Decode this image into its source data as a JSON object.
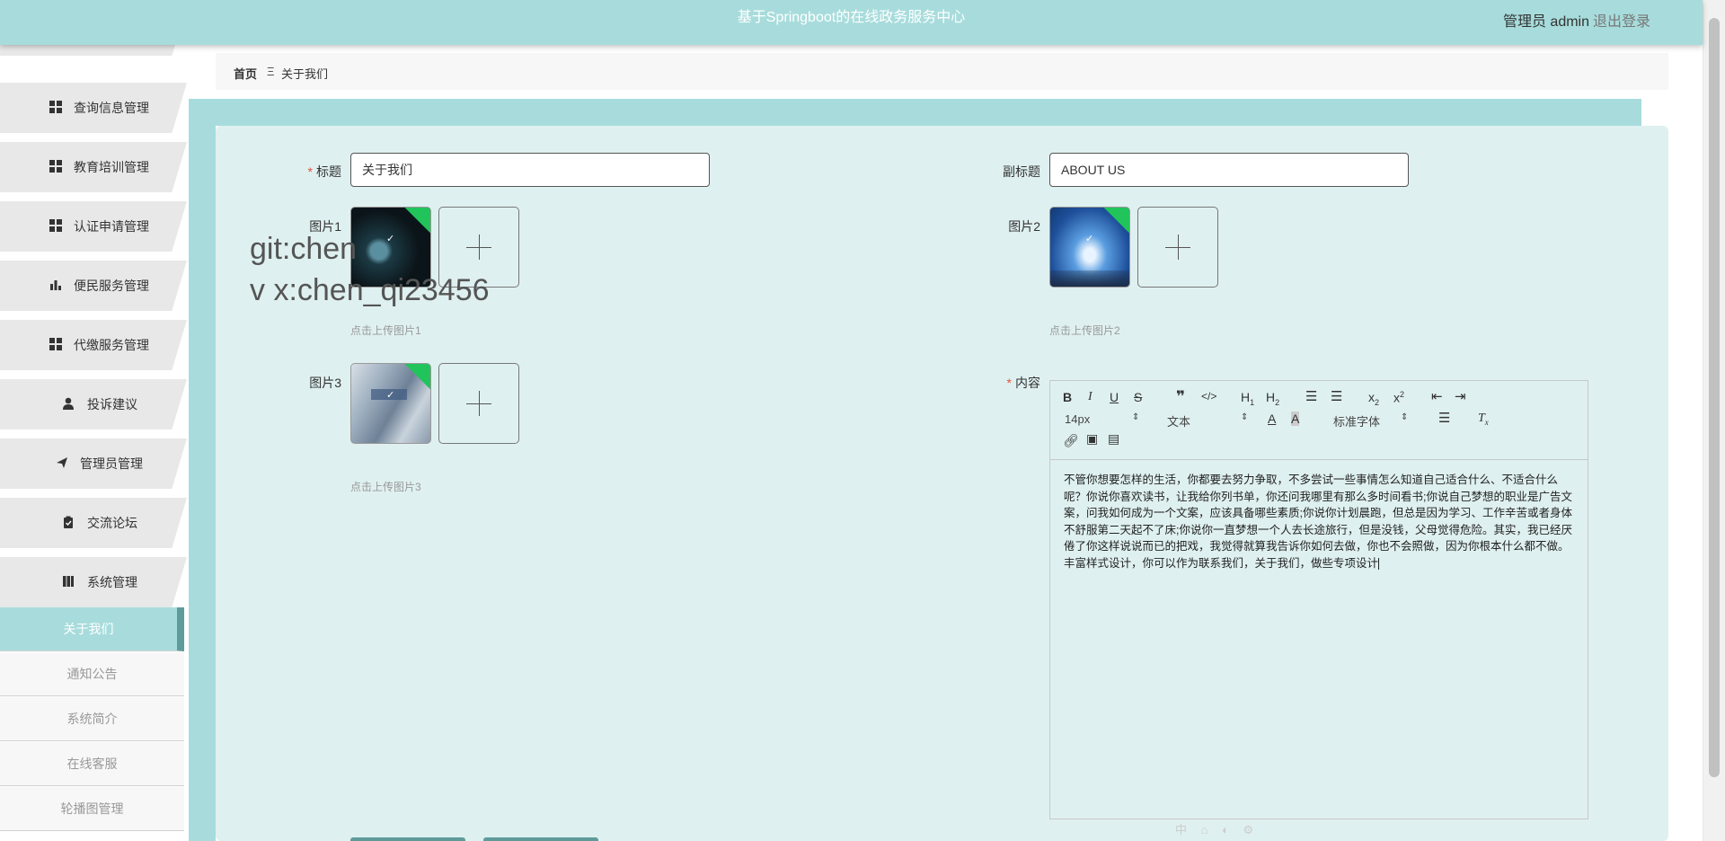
{
  "header": {
    "title": "基于Springboot的在线政务服务中心",
    "user": "管理员 admin",
    "logout": "退出登录"
  },
  "sidebar": {
    "items": [
      {
        "label": "查询信息管理",
        "icon": "grid-icon"
      },
      {
        "label": "教育培训管理",
        "icon": "grid-icon"
      },
      {
        "label": "认证申请管理",
        "icon": "grid-icon"
      },
      {
        "label": "便民服务管理",
        "icon": "bar-chart-icon"
      },
      {
        "label": "代缴服务管理",
        "icon": "grid-icon"
      },
      {
        "label": "投诉建议",
        "icon": "user-icon"
      },
      {
        "label": "管理员管理",
        "icon": "send-icon"
      },
      {
        "label": "交流论坛",
        "icon": "clipboard-icon"
      },
      {
        "label": "系统管理",
        "icon": "book-icon"
      }
    ],
    "submenu": [
      {
        "label": "关于我们",
        "active": true
      },
      {
        "label": "通知公告",
        "active": false
      },
      {
        "label": "系统简介",
        "active": false
      },
      {
        "label": "在线客服",
        "active": false
      },
      {
        "label": "轮播图管理",
        "active": false
      }
    ]
  },
  "breadcrumb": {
    "home": "首页",
    "separator": "Ξ",
    "current": "关于我们"
  },
  "form": {
    "title_label": "标题",
    "title_value": "关于我们",
    "subtitle_label": "副标题",
    "subtitle_value": "ABOUT US",
    "pic1_label": "图片1",
    "pic1_hint": "点击上传图片1",
    "pic2_label": "图片2",
    "pic2_hint": "点击上传图片2",
    "pic3_label": "图片3",
    "pic3_hint": "点击上传图片3",
    "content_label": "内容"
  },
  "watermark": "git:chen\nv x:chen_qi23456",
  "editor": {
    "font_size": "14px",
    "text_type": "文本",
    "font_family": "标准字体",
    "content": "不管你想要怎样的生活，你都要去努力争取，不多尝试一些事情怎么知道自己适合什么、不适合什么呢？你说你喜欢读书，让我给你列书单，你还问我哪里有那么多时间看书;你说自己梦想的职业是广告文案，问我如何成为一个文案，应该具备哪些素质;你说你计划晨跑，但总是因为学习、工作辛苦或者身体不舒服第二天起不了床;你说你一直梦想一个人去长途旅行，但是没钱，父母觉得危险。其实，我已经厌倦了你这样说说而已的把戏，我觉得就算我告诉你如何去做，你也不会照做，因为你根本什么都不做。丰富样式设计，你可以作为联系我们，关于我们，做些专项设计"
  },
  "colors": {
    "accent": "#a8dcdc",
    "card": "#dff0f0",
    "active_border": "#5f9b9b",
    "required": "#e5533a"
  }
}
